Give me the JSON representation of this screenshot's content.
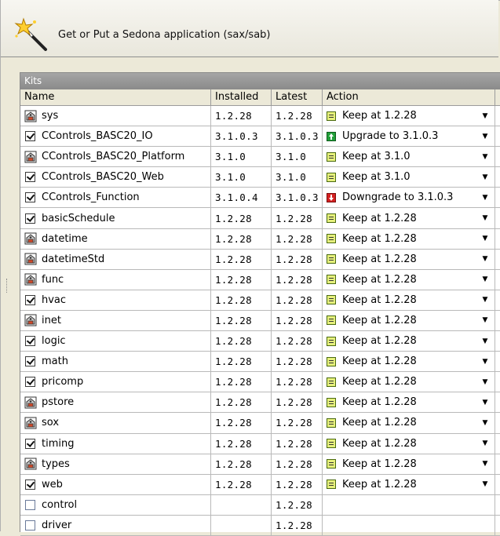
{
  "header": {
    "title": "Get or Put a Sedona application (sax/sab)",
    "icon": "magic-wand-icon"
  },
  "panel": {
    "title": "Kits"
  },
  "columns": {
    "name": "Name",
    "installed": "Installed",
    "latest": "Latest",
    "action": "Action"
  },
  "colors": {
    "keep": "#e6f07c",
    "upgrade": "#23a03a",
    "downgrade": "#d42020",
    "panel_title": "#8a8a8a"
  },
  "rows": [
    {
      "name": "sys",
      "icon": "locked-kit-icon",
      "installed": "1.2.28",
      "latest": "1.2.28",
      "action": "Keep at 1.2.28",
      "action_type": "keep"
    },
    {
      "name": "CControls_BASC20_IO",
      "icon": "checkbox-checked",
      "installed": "3.1.0.3",
      "latest": "3.1.0.3",
      "action": "Upgrade to 3.1.0.3",
      "action_type": "upgrade"
    },
    {
      "name": "CControls_BASC20_Platform",
      "icon": "locked-kit-icon",
      "installed": "3.1.0",
      "latest": "3.1.0",
      "action": "Keep at 3.1.0",
      "action_type": "keep"
    },
    {
      "name": "CControls_BASC20_Web",
      "icon": "checkbox-checked",
      "installed": "3.1.0",
      "latest": "3.1.0",
      "action": "Keep at 3.1.0",
      "action_type": "keep"
    },
    {
      "name": "CControls_Function",
      "icon": "checkbox-checked",
      "installed": "3.1.0.4",
      "latest": "3.1.0.3",
      "action": "Downgrade to 3.1.0.3",
      "action_type": "downgrade"
    },
    {
      "name": "basicSchedule",
      "icon": "checkbox-checked",
      "installed": "1.2.28",
      "latest": "1.2.28",
      "action": "Keep at 1.2.28",
      "action_type": "keep"
    },
    {
      "name": "datetime",
      "icon": "locked-kit-icon",
      "installed": "1.2.28",
      "latest": "1.2.28",
      "action": "Keep at 1.2.28",
      "action_type": "keep"
    },
    {
      "name": "datetimeStd",
      "icon": "locked-kit-icon",
      "installed": "1.2.28",
      "latest": "1.2.28",
      "action": "Keep at 1.2.28",
      "action_type": "keep"
    },
    {
      "name": "func",
      "icon": "locked-kit-icon",
      "installed": "1.2.28",
      "latest": "1.2.28",
      "action": "Keep at 1.2.28",
      "action_type": "keep"
    },
    {
      "name": "hvac",
      "icon": "checkbox-checked",
      "installed": "1.2.28",
      "latest": "1.2.28",
      "action": "Keep at 1.2.28",
      "action_type": "keep"
    },
    {
      "name": "inet",
      "icon": "locked-kit-icon",
      "installed": "1.2.28",
      "latest": "1.2.28",
      "action": "Keep at 1.2.28",
      "action_type": "keep"
    },
    {
      "name": "logic",
      "icon": "checkbox-checked",
      "installed": "1.2.28",
      "latest": "1.2.28",
      "action": "Keep at 1.2.28",
      "action_type": "keep"
    },
    {
      "name": "math",
      "icon": "checkbox-checked",
      "installed": "1.2.28",
      "latest": "1.2.28",
      "action": "Keep at 1.2.28",
      "action_type": "keep"
    },
    {
      "name": "pricomp",
      "icon": "checkbox-checked",
      "installed": "1.2.28",
      "latest": "1.2.28",
      "action": "Keep at 1.2.28",
      "action_type": "keep"
    },
    {
      "name": "pstore",
      "icon": "locked-kit-icon",
      "installed": "1.2.28",
      "latest": "1.2.28",
      "action": "Keep at 1.2.28",
      "action_type": "keep"
    },
    {
      "name": "sox",
      "icon": "locked-kit-icon",
      "installed": "1.2.28",
      "latest": "1.2.28",
      "action": "Keep at 1.2.28",
      "action_type": "keep"
    },
    {
      "name": "timing",
      "icon": "checkbox-checked",
      "installed": "1.2.28",
      "latest": "1.2.28",
      "action": "Keep at 1.2.28",
      "action_type": "keep"
    },
    {
      "name": "types",
      "icon": "locked-kit-icon",
      "installed": "1.2.28",
      "latest": "1.2.28",
      "action": "Keep at 1.2.28",
      "action_type": "keep"
    },
    {
      "name": "web",
      "icon": "checkbox-checked",
      "installed": "1.2.28",
      "latest": "1.2.28",
      "action": "Keep at 1.2.28",
      "action_type": "keep"
    },
    {
      "name": "control",
      "icon": "checkbox-unchecked",
      "installed": "",
      "latest": "1.2.28",
      "action": "",
      "action_type": "none"
    },
    {
      "name": "driver",
      "icon": "checkbox-unchecked",
      "installed": "",
      "latest": "1.2.28",
      "action": "",
      "action_type": "none"
    }
  ]
}
